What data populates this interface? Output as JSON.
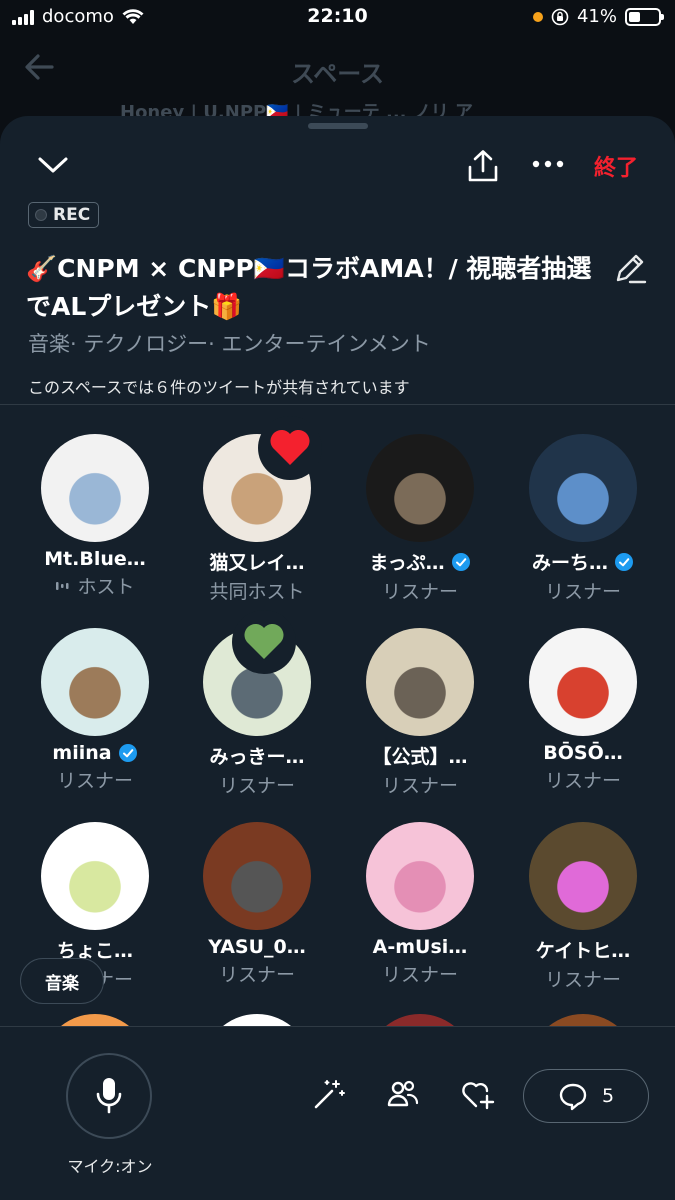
{
  "status_bar": {
    "carrier": "docomo",
    "time": "22:10",
    "battery": "41%"
  },
  "background": {
    "title": "スペース",
    "subtitle": "Honey    |    U.NPP🇵🇭  | ミューテ ... ノリ ア"
  },
  "space": {
    "end_label": "終了",
    "rec_label": "REC",
    "title": "🎸CNPM × CNPP🇵🇭コラボAMA！/ 視聴者抽選でALプレゼント🎁",
    "topics": "音楽· テクノロジー· エンターテインメント",
    "shared_tweets": "このスペースでは６件のツイートが共有されています"
  },
  "participants": [
    {
      "name": "Mt.Blue…",
      "role": "ホスト",
      "verified": false,
      "speaking": true,
      "bg": "#f2f2f2",
      "fg": "#9ab7d6"
    },
    {
      "name": "猫又レイ…",
      "role": "共同ホスト",
      "verified": false,
      "speaking": false,
      "bg": "#eee8e0",
      "fg": "#c9a27a"
    },
    {
      "name": "まっぷ…",
      "role": "リスナー",
      "verified": true,
      "speaking": false,
      "bg": "#1a1a1a",
      "fg": "#7b6b58"
    },
    {
      "name": "みーち…",
      "role": "リスナー",
      "verified": true,
      "speaking": false,
      "bg": "#20344a",
      "fg": "#5d8fc9"
    },
    {
      "name": "miina",
      "role": "リスナー",
      "verified": true,
      "speaking": false,
      "bg": "#d9ecec",
      "fg": "#9c7b5a"
    },
    {
      "name": "みっきー…",
      "role": "リスナー",
      "verified": false,
      "speaking": false,
      "bg": "#dfe9d5",
      "fg": "#5c6b75"
    },
    {
      "name": "【公式】…",
      "role": "リスナー",
      "verified": false,
      "speaking": false,
      "bg": "#d8cfb8",
      "fg": "#6b6256"
    },
    {
      "name": "BŌSŌ…",
      "role": "リスナー",
      "verified": false,
      "speaking": false,
      "bg": "#f5f5f5",
      "fg": "#d8412f"
    },
    {
      "name": "ちょこ…",
      "role": "リスナー",
      "verified": false,
      "speaking": false,
      "bg": "#ffffff",
      "fg": "#d8e8a0"
    },
    {
      "name": "YASU_0…",
      "role": "リスナー",
      "verified": false,
      "speaking": false,
      "bg": "#7a3a22",
      "fg": "#555555"
    },
    {
      "name": "A-mUsi…",
      "role": "リスナー",
      "verified": false,
      "speaking": false,
      "bg": "#f6c3d8",
      "fg": "#e48fb5"
    },
    {
      "name": "ケイトヒ…",
      "role": "リスナー",
      "verified": false,
      "speaking": false,
      "bg": "#5b4a2f",
      "fg": "#e06ad8"
    },
    {
      "name": "",
      "role": "",
      "verified": false,
      "speaking": false,
      "bg": "#f29a4a",
      "fg": "#d95aa0"
    },
    {
      "name": "",
      "role": "",
      "verified": false,
      "speaking": false,
      "bg": "#ffffff",
      "fg": "#6b6b6b"
    },
    {
      "name": "",
      "role": "",
      "verified": false,
      "speaking": false,
      "bg": "#8a2a2a",
      "fg": "#c98a8a"
    },
    {
      "name": "",
      "role": "",
      "verified": false,
      "speaking": false,
      "bg": "#8a4a22",
      "fg": "#9a9a9a"
    }
  ],
  "reactions": [
    {
      "icon": "red-heart-icon",
      "color": "#f4212e"
    },
    {
      "icon": "green-heart-icon",
      "color": "#71a95a"
    }
  ],
  "topic_chip": "音楽",
  "bottom_bar": {
    "mic_label": "マイク:オン",
    "replies_count": "5"
  },
  "colors": {
    "accent_red": "#f4212e",
    "verified_blue": "#1d9bf0",
    "sheet_bg": "#15202b"
  }
}
